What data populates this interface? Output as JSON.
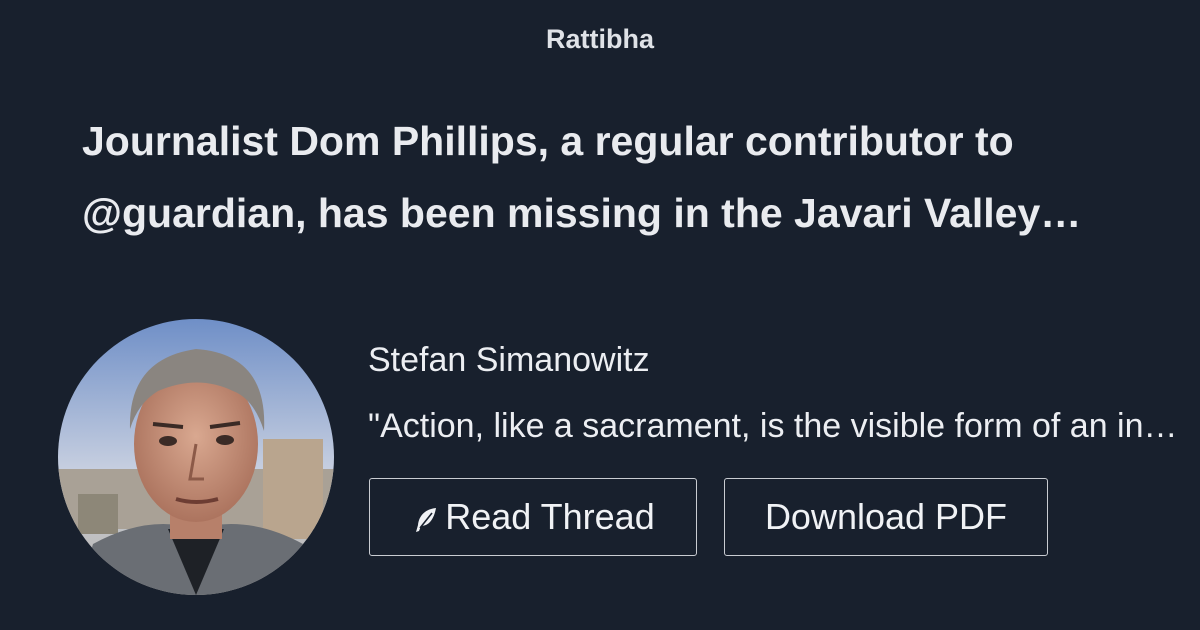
{
  "site": {
    "brand": "Rattibha"
  },
  "thread": {
    "headline": "Journalist Dom Phillips, a regular contributor to @guardian, has been missing in the Javari Valley since Sunday"
  },
  "author": {
    "name": "Stefan Simanowitz",
    "bio": "\"Action, like a sacrament, is the visible form of an invisible spirit\""
  },
  "actions": {
    "read_label": "Read Thread",
    "read_icon": "feather-icon",
    "pdf_label": "Download PDF"
  },
  "colors": {
    "background": "#18202d",
    "text": "#e9ebef",
    "button_border": "#c9ccd2"
  }
}
